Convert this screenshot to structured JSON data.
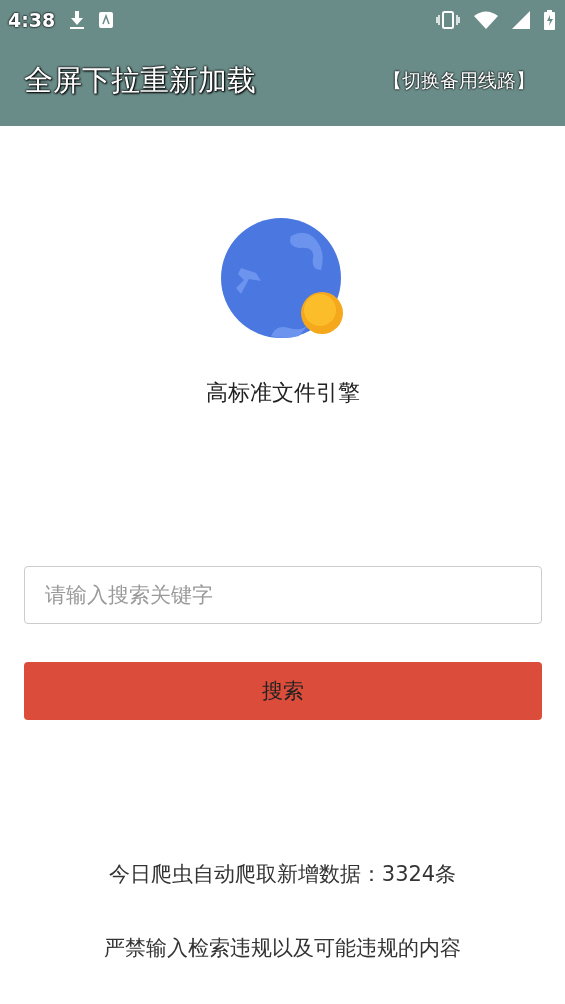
{
  "status_bar": {
    "time": "4:38"
  },
  "toolbar": {
    "title": "全屏下拉重新加载",
    "action": "【切换备用线路】"
  },
  "app_name": "高标准文件引擎",
  "search": {
    "placeholder": "请输入搜索关键字"
  },
  "search_button": "搜索",
  "stats": "今日爬虫自动爬取新增数据：3324条",
  "notice": "严禁输入检索违规以及可能违规的内容"
}
